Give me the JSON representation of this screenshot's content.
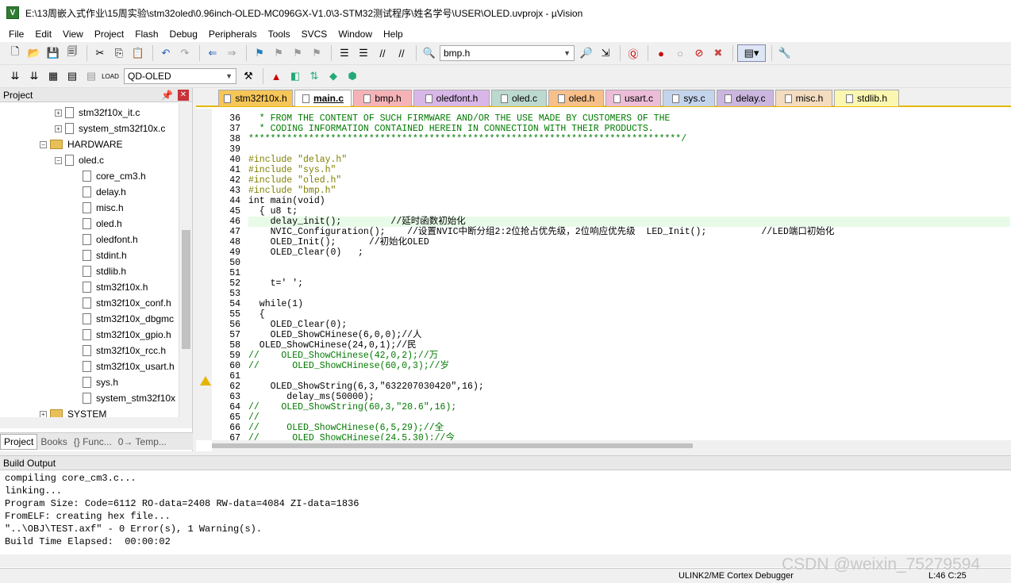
{
  "window": {
    "title": "E:\\13周嵌入式作业\\15周实验\\stm32oled\\0.96inch-OLED-MC096GX-V1.0\\3-STM32测试程序\\姓名学号\\USER\\OLED.uvprojx - µVision",
    "icon": "keil-uvision-icon"
  },
  "menu": [
    "File",
    "Edit",
    "View",
    "Project",
    "Flash",
    "Debug",
    "Peripherals",
    "Tools",
    "SVCS",
    "Window",
    "Help"
  ],
  "toolbar1": {
    "find_combo": "bmp.h"
  },
  "toolbar2": {
    "target_combo": "QD-OLED"
  },
  "project_pane": {
    "title": "Project",
    "tree": [
      {
        "label": "stm32f10x_it.c",
        "kind": "file",
        "level": 3,
        "expander": "+"
      },
      {
        "label": "system_stm32f10x.c",
        "kind": "file",
        "level": 3,
        "expander": "+"
      },
      {
        "label": "HARDWARE",
        "kind": "folder",
        "level": 2,
        "expander": "-"
      },
      {
        "label": "oled.c",
        "kind": "file",
        "level": 3,
        "expander": "-"
      },
      {
        "label": "core_cm3.h",
        "kind": "file",
        "level": 4
      },
      {
        "label": "delay.h",
        "kind": "file",
        "level": 4
      },
      {
        "label": "misc.h",
        "kind": "file",
        "level": 4
      },
      {
        "label": "oled.h",
        "kind": "file",
        "level": 4
      },
      {
        "label": "oledfont.h",
        "kind": "file",
        "level": 4
      },
      {
        "label": "stdint.h",
        "kind": "file",
        "level": 4
      },
      {
        "label": "stdlib.h",
        "kind": "file",
        "level": 4
      },
      {
        "label": "stm32f10x.h",
        "kind": "file",
        "level": 4
      },
      {
        "label": "stm32f10x_conf.h",
        "kind": "file",
        "level": 4
      },
      {
        "label": "stm32f10x_dbgmc",
        "kind": "file",
        "level": 4
      },
      {
        "label": "stm32f10x_gpio.h",
        "kind": "file",
        "level": 4
      },
      {
        "label": "stm32f10x_rcc.h",
        "kind": "file",
        "level": 4
      },
      {
        "label": "stm32f10x_usart.h",
        "kind": "file",
        "level": 4
      },
      {
        "label": "sys.h",
        "kind": "file",
        "level": 4
      },
      {
        "label": "system_stm32f10x",
        "kind": "file",
        "level": 4
      },
      {
        "label": "SYSTEM",
        "kind": "folder",
        "level": 2,
        "expander": "+"
      }
    ],
    "tabs": [
      "Project",
      "Books",
      "{} Func...",
      "0→ Temp..."
    ]
  },
  "editor": {
    "tabs": [
      {
        "label": "stm32f10x.h",
        "color": "#f6c659"
      },
      {
        "label": "main.c",
        "color": "#e9dfa0",
        "active": true
      },
      {
        "label": "bmp.h",
        "color": "#f5b3b8"
      },
      {
        "label": "oledfont.h",
        "color": "#d8b7e8"
      },
      {
        "label": "oled.c",
        "color": "#bcd9cf"
      },
      {
        "label": "oled.h",
        "color": "#f7c08a"
      },
      {
        "label": "usart.c",
        "color": "#ecbcd8"
      },
      {
        "label": "sys.c",
        "color": "#c4d4ec"
      },
      {
        "label": "delay.c",
        "color": "#cbb6e0"
      },
      {
        "label": "misc.h",
        "color": "#f4dcc0"
      },
      {
        "label": "stdlib.h",
        "color": "#fbf7b0"
      }
    ],
    "current_line": 46,
    "warning_line": 62,
    "lines": [
      {
        "no": "36",
        "text": "  * FROM THE CONTENT OF SUCH FIRMWARE AND/OR THE USE MADE BY CUSTOMERS OF THE",
        "style": "com"
      },
      {
        "no": "37",
        "text": "  * CODING INFORMATION CONTAINED HEREIN IN CONNECTION WITH THEIR PRODUCTS.",
        "style": "com"
      },
      {
        "no": "38",
        "text": "*******************************************************************************/",
        "style": "com"
      },
      {
        "no": "39",
        "text": "",
        "style": ""
      },
      {
        "no": "40",
        "text": "#include \"delay.h\"",
        "style": "pre"
      },
      {
        "no": "41",
        "text": "#include \"sys.h\"",
        "style": "pre"
      },
      {
        "no": "42",
        "text": "#include \"oled.h\"",
        "style": "pre"
      },
      {
        "no": "43",
        "text": "#include \"bmp.h\"",
        "style": "pre"
      },
      {
        "no": "44",
        "text": "int main(void)",
        "style": ""
      },
      {
        "no": "45",
        "text": "  { u8 t;",
        "style": ""
      },
      {
        "no": "46",
        "text": "    delay_init();         //延时函数初始化",
        "style": ""
      },
      {
        "no": "47",
        "text": "    NVIC_Configuration();    //设置NVIC中断分组2:2位抢占优先级，2位响应优先级  LED_Init();          //LED端口初始化",
        "style": ""
      },
      {
        "no": "48",
        "text": "    OLED_Init();      //初始化OLED",
        "style": ""
      },
      {
        "no": "49",
        "text": "    OLED_Clear(0)   ;",
        "style": ""
      },
      {
        "no": "50",
        "text": "",
        "style": ""
      },
      {
        "no": "51",
        "text": "",
        "style": ""
      },
      {
        "no": "52",
        "text": "    t=' ';",
        "style": ""
      },
      {
        "no": "53",
        "text": "",
        "style": ""
      },
      {
        "no": "54",
        "text": "  while(1)",
        "style": ""
      },
      {
        "no": "55",
        "text": "  {",
        "style": ""
      },
      {
        "no": "56",
        "text": "    OLED_Clear(0);",
        "style": ""
      },
      {
        "no": "57",
        "text": "    OLED_ShowCHinese(6,0,0);//人",
        "style": ""
      },
      {
        "no": "58",
        "text": "  OLED_ShowCHinese(24,0,1);//民",
        "style": ""
      },
      {
        "no": "59",
        "text": "//    OLED_ShowCHinese(42,0,2);//万",
        "style": "com"
      },
      {
        "no": "60",
        "text": "//      OLED_ShowCHinese(60,0,3);//岁",
        "style": "com"
      },
      {
        "no": "61",
        "text": "",
        "style": ""
      },
      {
        "no": "62",
        "text": "    OLED_ShowString(6,3,\"632207030420\",16);",
        "style": ""
      },
      {
        "no": "63",
        "text": "       delay_ms(50000);",
        "style": ""
      },
      {
        "no": "64",
        "text": "//    OLED_ShowString(60,3,\"20.6\",16);",
        "style": "com"
      },
      {
        "no": "65",
        "text": "//",
        "style": "com"
      },
      {
        "no": "66",
        "text": "//     OLED_ShowCHinese(6,5,29);//全",
        "style": "com"
      },
      {
        "no": "67",
        "text": "//      OLED_ShowCHinese(24,5,30);//今",
        "style": "com"
      }
    ]
  },
  "build_output": {
    "title": "Build Output",
    "lines": [
      "compiling core_cm3.c...",
      "linking...",
      "Program Size: Code=6112 RO-data=2408 RW-data=4084 ZI-data=1836",
      "FromELF: creating hex file...",
      "\"..\\OBJ\\TEST.axf\" - 0 Error(s), 1 Warning(s).",
      "Build Time Elapsed:  00:00:02"
    ]
  },
  "status": {
    "debugger": "ULINK2/ME Cortex Debugger",
    "position": "L:46 C:25"
  },
  "watermark": "CSDN @weixin_75279594"
}
